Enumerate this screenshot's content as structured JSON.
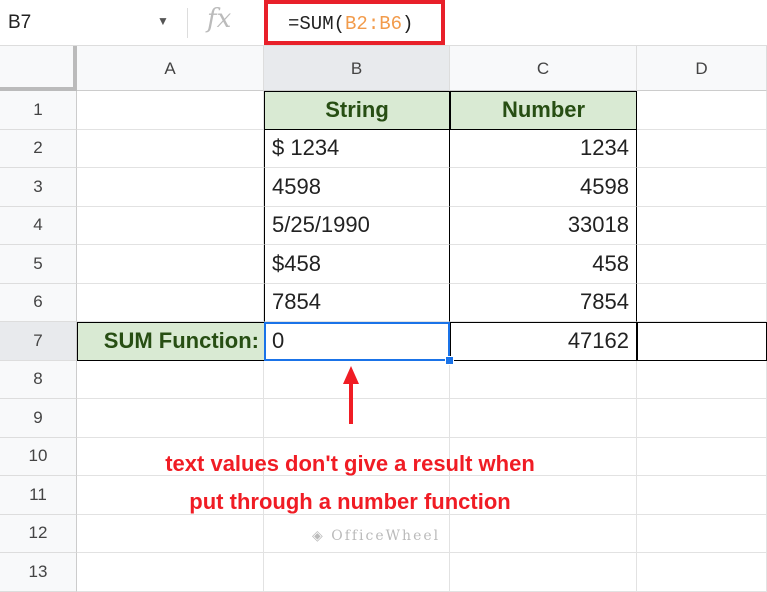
{
  "formula_bar": {
    "name_box": "B7",
    "fx_label": "fx",
    "formula_prefix": "=SUM(",
    "formula_ref": "B2:B6",
    "formula_suffix": ")"
  },
  "columns": [
    "A",
    "B",
    "C",
    "D"
  ],
  "rows": [
    "1",
    "2",
    "3",
    "4",
    "5",
    "6",
    "7",
    "8",
    "9",
    "10",
    "11",
    "12",
    "13"
  ],
  "table": {
    "headers": [
      "String",
      "Number"
    ],
    "data": [
      [
        "$ 1234",
        "1234"
      ],
      [
        "4598",
        "4598"
      ],
      [
        "5/25/1990",
        "33018"
      ],
      [
        "$458",
        "458"
      ],
      [
        "7854",
        "7854"
      ]
    ],
    "sum_label": "SUM Function:",
    "sum_values": [
      "0",
      "47162"
    ]
  },
  "annotation": "text values don't give a result when put through a number function",
  "watermark": "OfficeWheel",
  "colors": {
    "highlight_box": "#e8202a",
    "selection": "#1a73e8",
    "header_fill": "#d9ead3",
    "annotation": "#f01c24"
  }
}
